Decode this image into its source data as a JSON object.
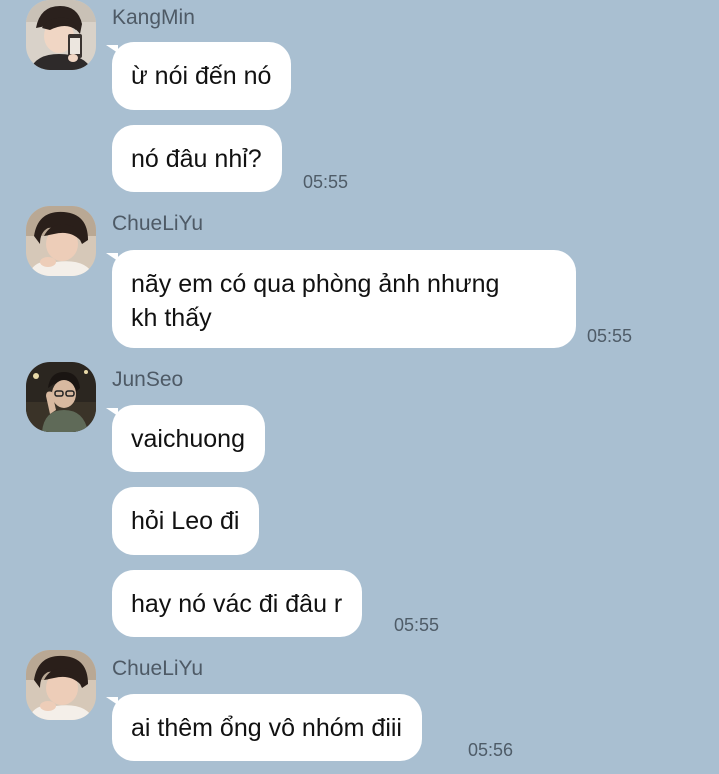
{
  "colors": {
    "background": "#a9bfd1",
    "bubble": "#ffffff",
    "name_text": "#4e5a66",
    "time_text": "#4f5c68"
  },
  "messages": [
    {
      "sender": "KangMin",
      "avatar_icon": "avatar-kangmin-icon",
      "bubbles": [
        "ừ nói đến nó",
        "nó đâu nhỉ?"
      ],
      "time": "05:55"
    },
    {
      "sender": "ChueLiYu",
      "avatar_icon": "avatar-chueliyu-icon",
      "bubbles": [
        "nãy em có qua phòng ảnh nhưng\nkh thấy"
      ],
      "time": "05:55"
    },
    {
      "sender": "JunSeo",
      "avatar_icon": "avatar-junseo-icon",
      "bubbles": [
        "vaichuong",
        "hỏi Leo đi",
        "hay nó vác đi đâu r"
      ],
      "time": "05:55"
    },
    {
      "sender": "ChueLiYu",
      "avatar_icon": "avatar-chueliyu-icon",
      "bubbles": [
        "ai thêm ổng vô nhóm điii"
      ],
      "time": "05:56"
    }
  ]
}
